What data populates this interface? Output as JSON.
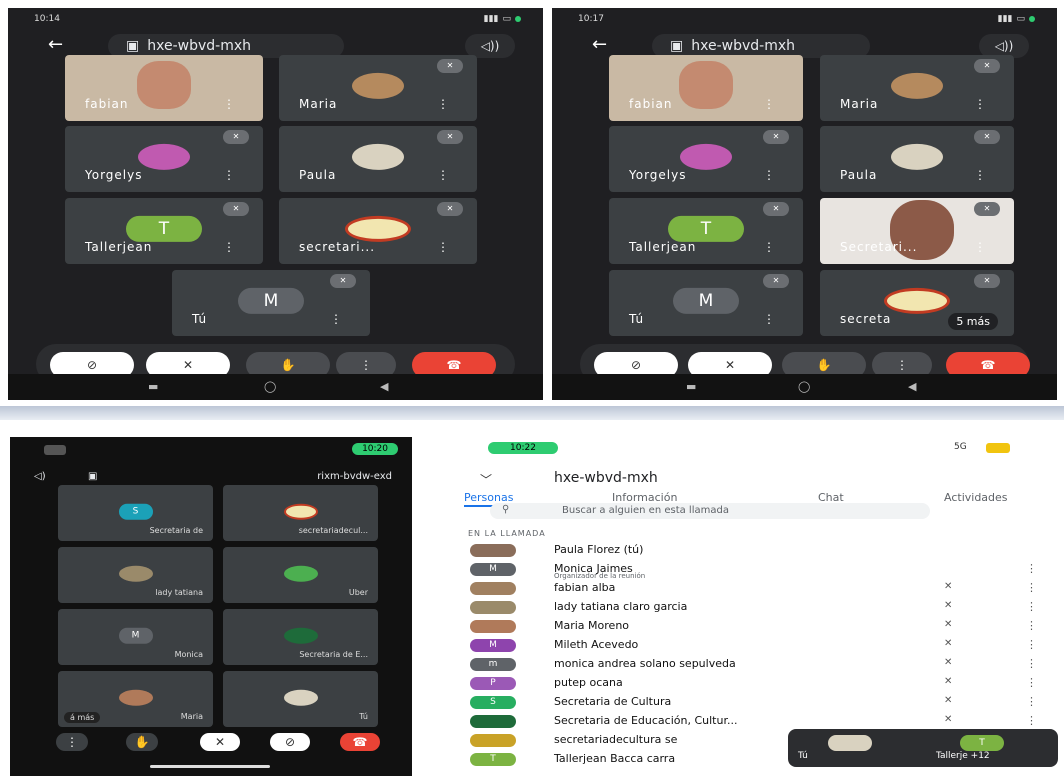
{
  "meeting_code": "hxe-wbvd-mxh",
  "speaker_label": "◁))",
  "phone1": {
    "time": "10:14",
    "tiles": [
      "fabian",
      "Maria",
      "Yorgelys",
      "Paula",
      "Tallerjean",
      "secretari...",
      "Tú"
    ],
    "avatar_T": "T",
    "avatar_M": "M"
  },
  "phone2": {
    "time": "10:17",
    "tiles": [
      "fabian",
      "Maria",
      "Yorgelys",
      "Paula",
      "Tallerjean",
      "Secretari...",
      "Tú",
      "secreta"
    ],
    "more": "5 más",
    "avatar_T": "T",
    "avatar_M": "M"
  },
  "phone3": {
    "time": "10:20",
    "code_mirrored": "rixm-bvdw-exd",
    "tiles": [
      "Secretaria de",
      "secretariadecul...",
      "lady tatiana",
      "Uber",
      "Monica",
      "Secretaria de E...",
      "Maria",
      "Tú"
    ],
    "more": "á más",
    "avatar_S": "S",
    "avatar_M": "M"
  },
  "phone4": {
    "time": "10:22",
    "signal": "5G",
    "title": "hxe-wbvd-mxh",
    "tabs": [
      "Personas",
      "Información",
      "Chat",
      "Actividades"
    ],
    "search_placeholder": "Buscar a alguien en esta llamada",
    "section": "EN LA LLAMADA",
    "people": [
      {
        "name": "Paula Florez (tú)",
        "avatar": "",
        "color": "#8a6d5a"
      },
      {
        "name": "Monica Jaimes",
        "sub": "Organizador de la reunión",
        "avatar": "M",
        "color": "#5f6368"
      },
      {
        "name": "fabian alba",
        "avatar": "",
        "color": "#a08060"
      },
      {
        "name": "lady tatiana claro garcia",
        "avatar": "",
        "color": "#9a8a6a"
      },
      {
        "name": "Maria Moreno",
        "avatar": "",
        "color": "#b07a5a"
      },
      {
        "name": "Mileth Acevedo",
        "avatar": "M",
        "color": "#8e44ad"
      },
      {
        "name": "monica andrea solano sepulveda",
        "avatar": "m",
        "color": "#5f6368"
      },
      {
        "name": "putep ocana",
        "avatar": "P",
        "color": "#9b59b6"
      },
      {
        "name": "Secretaria de Cultura",
        "avatar": "S",
        "color": "#27ae60"
      },
      {
        "name": "Secretaria de Educación, Cultur...",
        "avatar": "",
        "color": "#1e6b3a"
      },
      {
        "name": "secretariadecultura se",
        "avatar": "",
        "color": "#c9a227"
      },
      {
        "name": "Tallerjean Bacca carra",
        "avatar": "T",
        "color": "#7cb342"
      }
    ],
    "mini_you": "Tú",
    "mini_other": "Tallerje +12",
    "mini_avatar": "T"
  }
}
